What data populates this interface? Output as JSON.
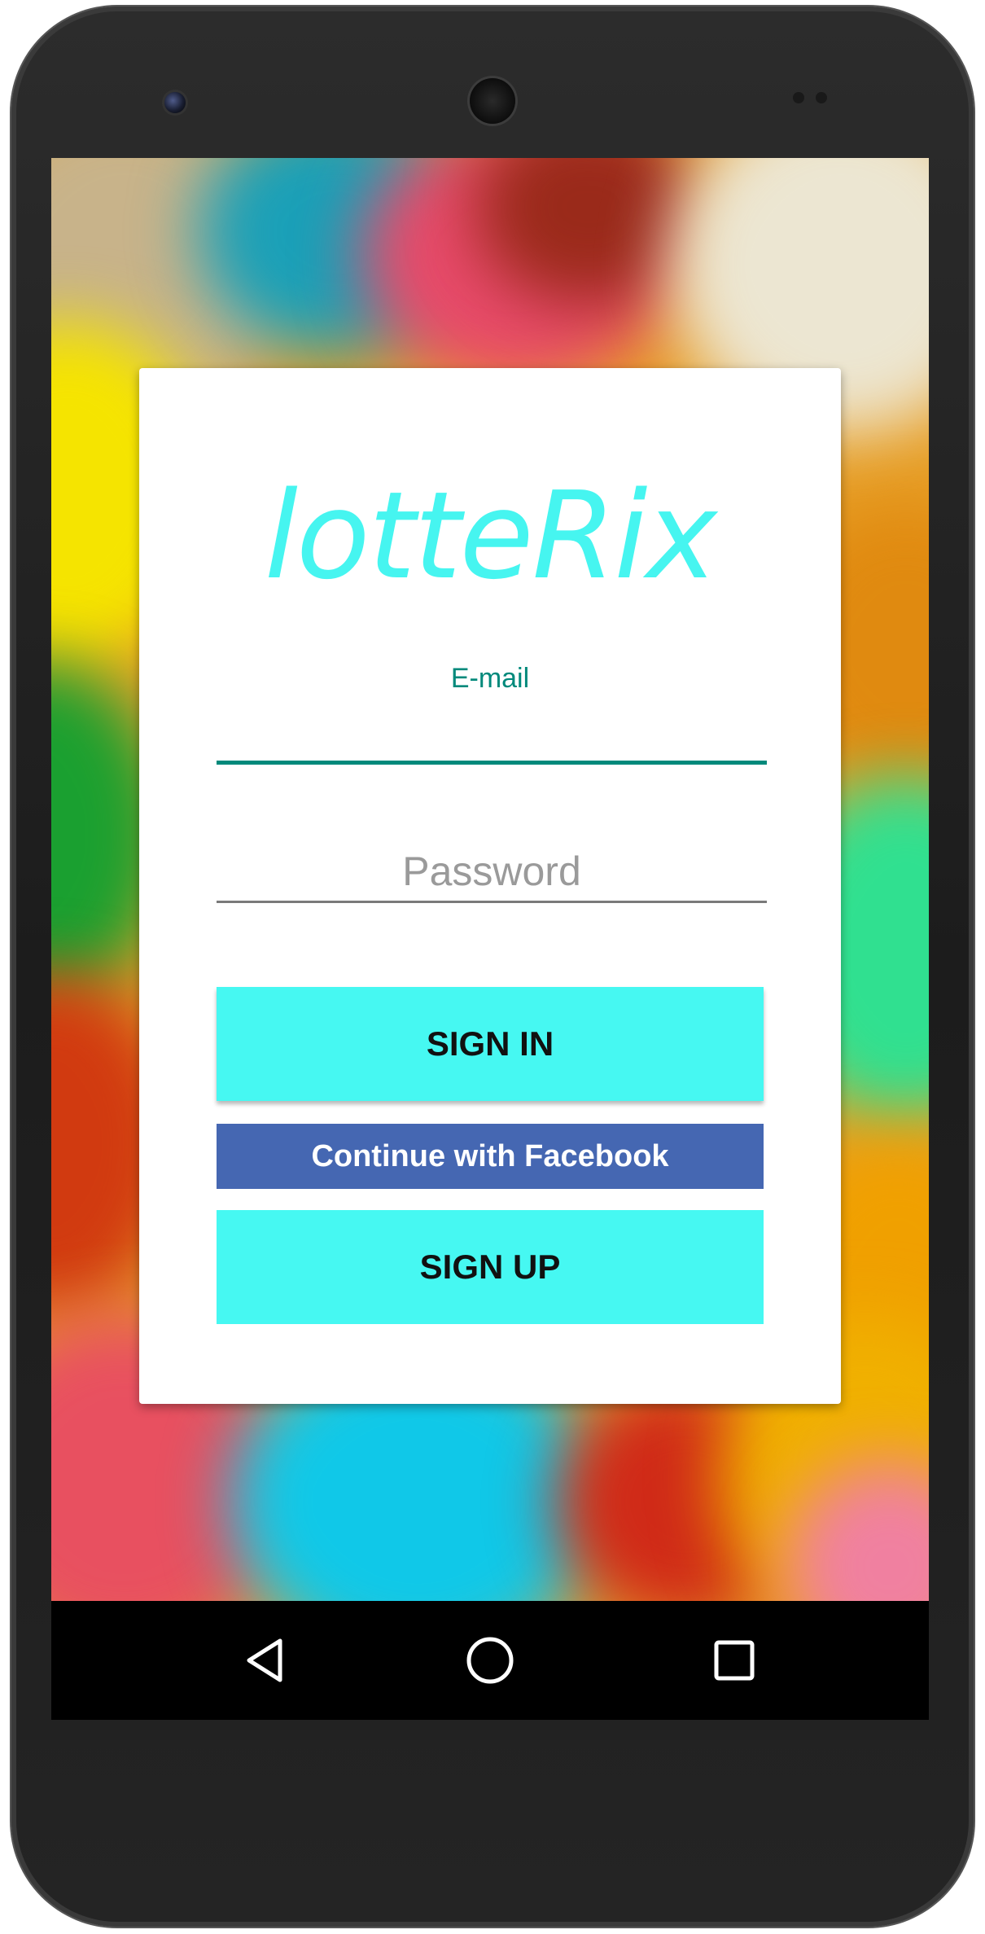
{
  "app": {
    "title": "lotteRix"
  },
  "login": {
    "email_label": "E-mail",
    "email_value": "",
    "password_placeholder": "Password",
    "password_value": ""
  },
  "buttons": {
    "sign_in": "SIGN IN",
    "facebook": "Continue with Facebook",
    "sign_up": "SIGN UP"
  },
  "navigation": {
    "back_icon": "back-triangle-icon",
    "home_icon": "home-circle-icon",
    "recents_icon": "recents-square-icon"
  },
  "colors": {
    "accent_cyan": "#46f8f2",
    "logo_cyan": "#46f5f0",
    "teal": "#00897b",
    "facebook_blue": "#4567b2"
  }
}
